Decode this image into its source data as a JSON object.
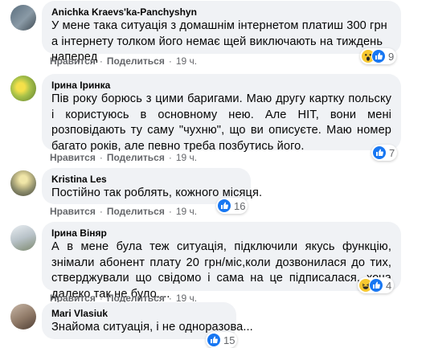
{
  "actions": {
    "like": "Нравится",
    "reply": "Поделиться"
  },
  "comments": [
    {
      "author": "Anichka Kraevs'ka-Panchyshyn",
      "text": "У мене така ситуація з домашнім інтернетом платиш 300 грн а інтернету толком його немає щей виключають на тиждень наперед",
      "time": "19 ч.",
      "reactions": [
        "wow",
        "like"
      ],
      "reaction_count": "9"
    },
    {
      "author": "Ірина Іринка",
      "text": "Пів року борюсь з цими баригами. Маю другу картку польску і користуюсь в основному нею. Але НІТ, вони мені розповідають ту саму \"чухню\", що ви описуєте. Маю номер багато років, але певно треба позбутись його.",
      "time": "19 ч.",
      "reactions": [
        "like"
      ],
      "reaction_count": "7"
    },
    {
      "author": "Kristina Les",
      "text": "Постійно так роблять, кожного місяця.",
      "time": "19 ч.",
      "reactions": [
        "like"
      ],
      "reaction_count": "16"
    },
    {
      "author": "Ірина Віняр",
      "text": "А в мене була теж ситуація, підключили якусь функцію, знімали абонент плату 20 грн/міс,коли дозвонилася до тих, стверджували що свідомо і сама на це підписалася, хоча далеко так не було....",
      "time": "19 ч.",
      "reactions": [
        "haha",
        "like"
      ],
      "reaction_count": "4"
    },
    {
      "author": "Mari Vlasiuk",
      "text": "Знайома ситуація, і не одноразова...",
      "time": "",
      "reactions": [
        "like"
      ],
      "reaction_count": "15"
    }
  ]
}
